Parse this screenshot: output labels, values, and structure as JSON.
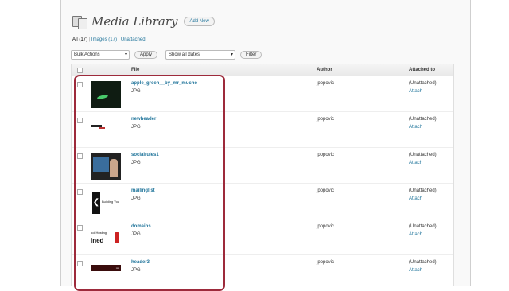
{
  "header": {
    "title": "Media Library",
    "add_new": "Add New"
  },
  "filters": [
    {
      "label": "All",
      "count": "(17)"
    },
    {
      "label": "Images",
      "count": "(17)"
    },
    {
      "label": "Unattached",
      "count": ""
    }
  ],
  "filter_sep": "|",
  "toolbar": {
    "bulk_actions": "Bulk Actions",
    "apply": "Apply",
    "dates": "Show all dates",
    "filter": "Filter"
  },
  "columns": {
    "file": "File",
    "author": "Author",
    "attached": "Attached to"
  },
  "rows": [
    {
      "name": "apple_green__by_mr_mucho",
      "type": "JPG",
      "author": "jpopovic",
      "attached": "(Unattached)",
      "action": "Attach"
    },
    {
      "name": "newheader",
      "type": "JPG",
      "author": "jpopovic",
      "attached": "(Unattached)",
      "action": "Attach"
    },
    {
      "name": "socialrules1",
      "type": "JPG",
      "author": "jpopovic",
      "attached": "(Unattached)",
      "action": "Attach"
    },
    {
      "name": "mailinglist",
      "type": "JPG",
      "author": "jpopovic",
      "attached": "(Unattached)",
      "action": "Attach"
    },
    {
      "name": "domains",
      "type": "JPG",
      "author": "jpopovic",
      "attached": "(Unattached)",
      "action": "Attach"
    },
    {
      "name": "header3",
      "type": "JPG",
      "author": "jpopovic",
      "attached": "(Unattached)",
      "action": "Attach"
    }
  ],
  "thumb_text": {
    "mailing": "Building You",
    "domain_small": "ool Hosting",
    "domain_big": "ined"
  },
  "colors": {
    "link": "#21759b",
    "highlight": "#9d2a3b"
  }
}
